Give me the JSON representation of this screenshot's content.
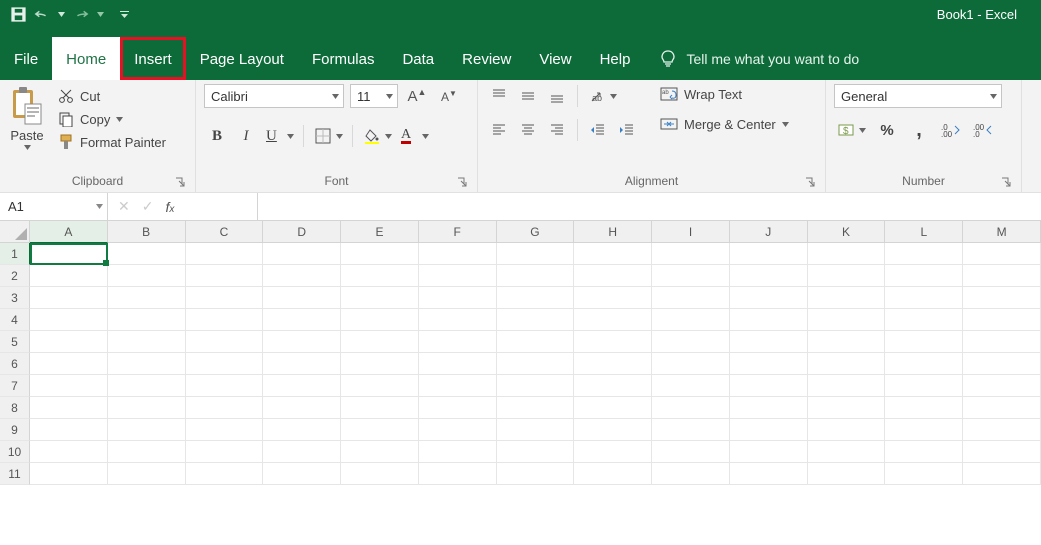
{
  "title": "Book1  -  Excel",
  "tabs": [
    "File",
    "Home",
    "Insert",
    "Page Layout",
    "Formulas",
    "Data",
    "Review",
    "View",
    "Help"
  ],
  "active_tab": "Home",
  "highlighted_tab": "Insert",
  "tellme": "Tell me what you want to do",
  "clipboard": {
    "paste": "Paste",
    "cut": "Cut",
    "copy": "Copy",
    "format_painter": "Format Painter",
    "group_label": "Clipboard"
  },
  "font": {
    "name": "Calibri",
    "size": "11",
    "group_label": "Font"
  },
  "alignment": {
    "wrap": "Wrap Text",
    "merge": "Merge & Center",
    "group_label": "Alignment"
  },
  "number": {
    "format": "General",
    "group_label": "Number"
  },
  "namebox": "A1",
  "columns": [
    "A",
    "B",
    "C",
    "D",
    "E",
    "F",
    "G",
    "H",
    "I",
    "J",
    "K",
    "L",
    "M"
  ],
  "rows": [
    "1",
    "2",
    "3",
    "4",
    "5",
    "6",
    "7",
    "8",
    "9",
    "10",
    "11"
  ]
}
